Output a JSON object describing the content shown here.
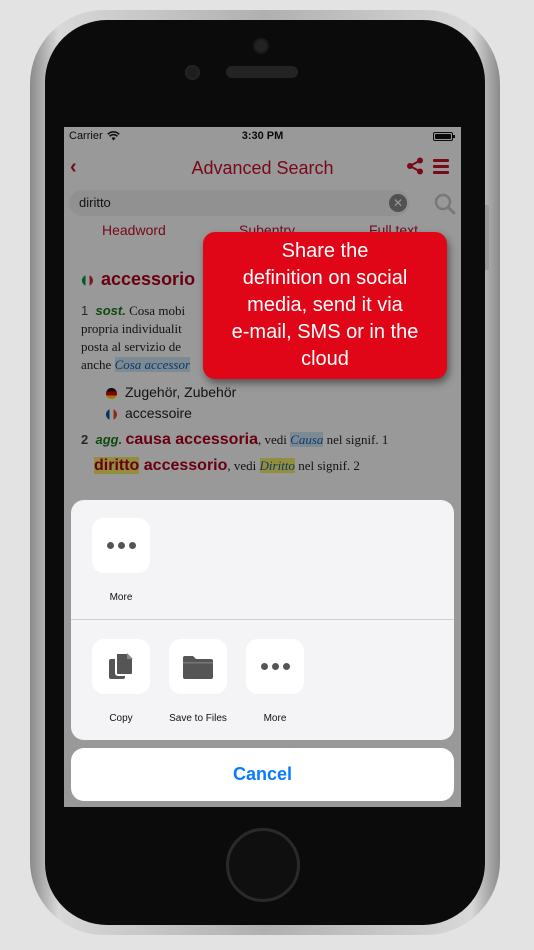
{
  "status": {
    "carrier": "Carrier",
    "time": "3:30 PM"
  },
  "nav": {
    "title": "Advanced Search",
    "back_icon": "chevron-left-icon",
    "share_icon": "share-icon",
    "menu_icon": "hamburger-menu-icon"
  },
  "search": {
    "value": "diritto"
  },
  "tabs": [
    "Headword",
    "Subentry",
    "Full text"
  ],
  "entry": {
    "headword": "accessorio",
    "sense1": {
      "num": "1",
      "pos": "sost.",
      "text_a": "Cosa mobi",
      "text_b": "propria individualit",
      "text_c": "posta al servizio de",
      "text_d": "anche",
      "xref": "Cosa accessor"
    },
    "translations": [
      {
        "lang": "de",
        "text": "Zugehör, Zubehör"
      },
      {
        "lang": "fr",
        "text": "accessoire"
      }
    ],
    "sense2": {
      "num": "2",
      "pos": "agg.",
      "phrase": "causa accessoria",
      "vedi": ", vedi",
      "xref": "Causa",
      "tail": "nel signif. 1"
    },
    "phrase2": {
      "hl": "diritto",
      "rest": " accessorio",
      "vedi": ", vedi",
      "xref": "Diritto",
      "tail": "nel signif. 2"
    }
  },
  "share_sheet": {
    "row1": [
      {
        "label": "More",
        "icon": "more-icon"
      }
    ],
    "row2": [
      {
        "label": "Copy",
        "icon": "copy-icon"
      },
      {
        "label": "Save to Files",
        "icon": "folder-icon"
      },
      {
        "label": "More",
        "icon": "more-icon"
      }
    ],
    "cancel": "Cancel"
  },
  "callout": {
    "lines": [
      "Share the",
      "definition on social",
      "media, send it via",
      "e-mail, SMS or in the",
      "cloud"
    ]
  },
  "colors": {
    "accent": "#c8102e",
    "callout": "#e00617",
    "link": "#0a7aff"
  }
}
